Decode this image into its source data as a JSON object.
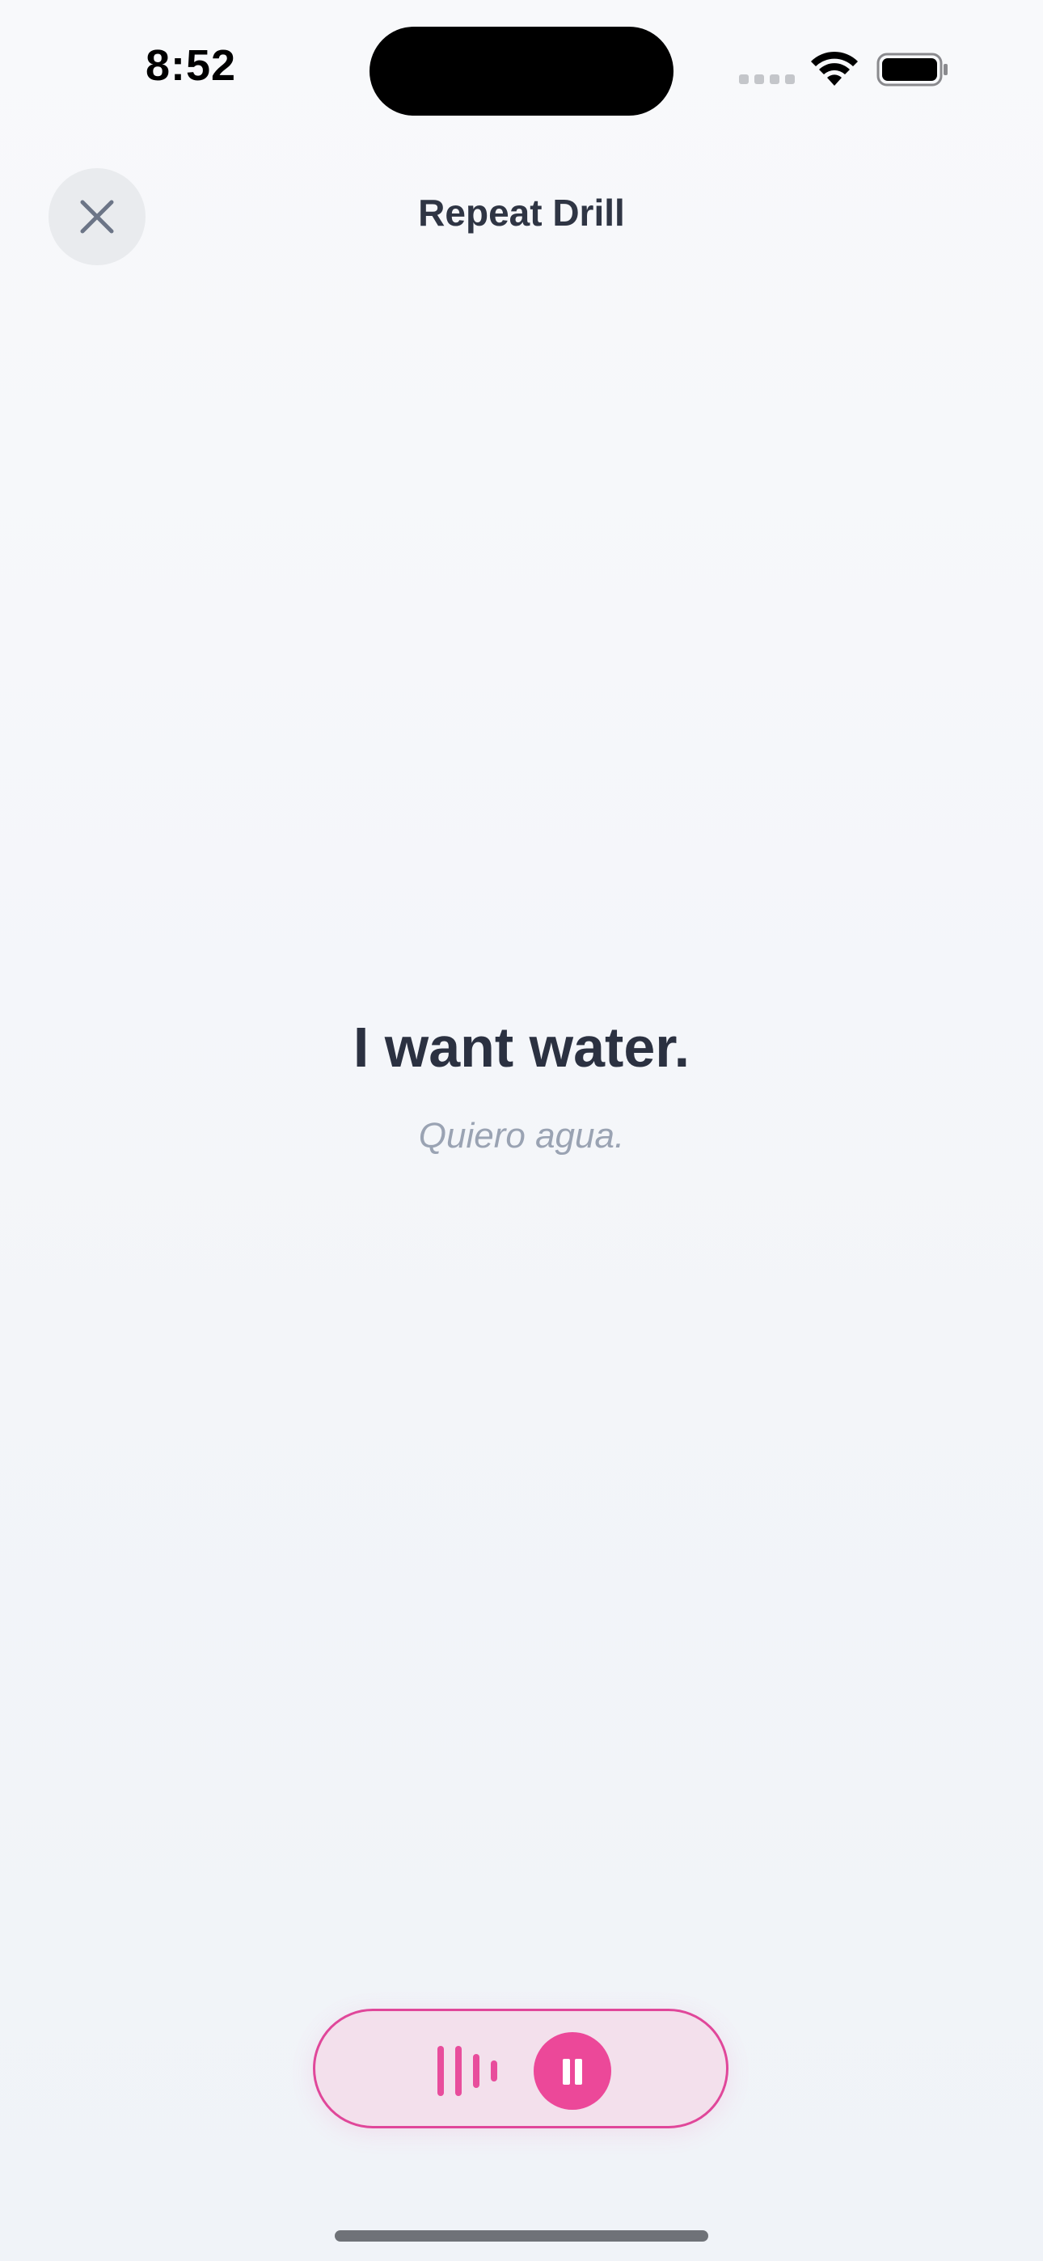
{
  "status_bar": {
    "time": "8:52"
  },
  "header": {
    "title": "Repeat Drill",
    "close_icon": "close-x-icon"
  },
  "drill": {
    "phrase": "I want water.",
    "translation": "Quiero agua."
  },
  "controls": {
    "waveform_icon": "audio-waveform-icon",
    "pause_icon": "pause-icon",
    "accent_color": "#ec4899"
  },
  "colors": {
    "title": "#2f3544",
    "phrase": "#2b3141",
    "translation": "#9aa3b3",
    "accent": "#ec4899",
    "pill_background": "#f3e0ec"
  }
}
